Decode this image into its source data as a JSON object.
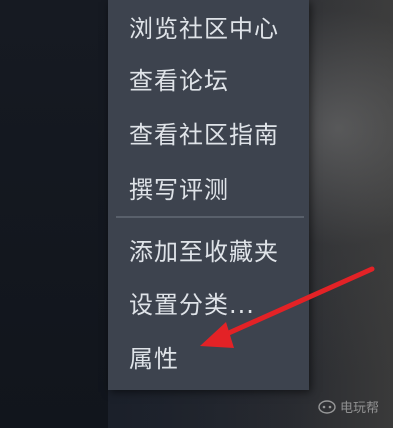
{
  "context_menu": {
    "items": [
      {
        "label": "浏览社区中心"
      },
      {
        "label": "查看论坛"
      },
      {
        "label": "查看社区指南"
      },
      {
        "label": "撰写评测"
      },
      {
        "label": "添加至收藏夹"
      },
      {
        "label": "设置分类..."
      },
      {
        "label": "属性"
      }
    ]
  },
  "watermark": {
    "text": "电玩帮"
  },
  "annotation": {
    "arrow_color": "#e32226",
    "points_to": "属性"
  }
}
